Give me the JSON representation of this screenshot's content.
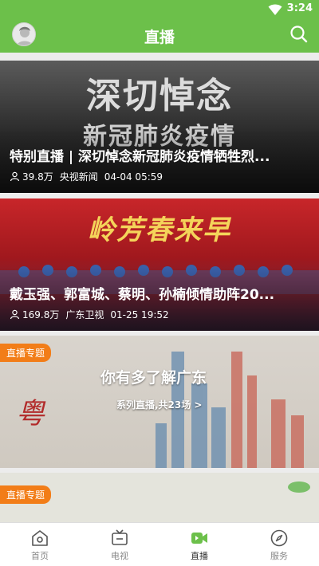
{
  "status_bar": {
    "time": "3:24"
  },
  "header": {
    "title": "直播",
    "accent": "#6cc04a"
  },
  "feed": {
    "items": [
      {
        "poster_text_top": "深切悼念",
        "poster_text_bottom": "新冠肺炎疫情",
        "title": "特别直播 | 深切悼念新冠肺炎疫情牺牲烈...",
        "views": "39.8万",
        "source": "央视新闻",
        "time": "04-04 05:59"
      },
      {
        "poster_text_top": "岭芳春来早",
        "title": "戴玉强、郭富城、蔡明、孙楠倾情助阵20...",
        "views": "169.8万",
        "source": "广东卫视",
        "time": "01-25 19:52"
      }
    ],
    "topics": [
      {
        "badge": "直播专题",
        "title": "你有多了解广东",
        "subtitle": "系列直播,共23场 >",
        "badge_color": "#f27d18"
      },
      {
        "badge": "直播专题"
      }
    ]
  },
  "tabbar": {
    "tabs": [
      {
        "label": "首页",
        "icon": "home-icon"
      },
      {
        "label": "电视",
        "icon": "tv-icon"
      },
      {
        "label": "直播",
        "icon": "live-video-icon",
        "active": true
      },
      {
        "label": "服务",
        "icon": "compass-icon"
      }
    ]
  }
}
